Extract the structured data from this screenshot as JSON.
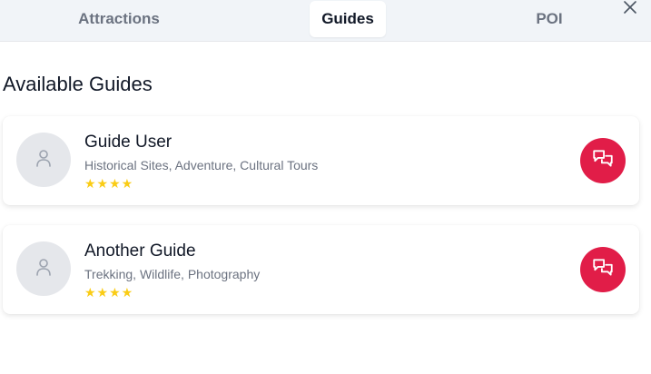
{
  "tabs": [
    {
      "label": "Attractions",
      "active": false
    },
    {
      "label": "Guides",
      "active": true
    },
    {
      "label": "POI",
      "active": false
    }
  ],
  "section_title": "Available Guides",
  "guides": [
    {
      "name": "Guide User",
      "specialties": "Historical Sites, Adventure, Cultural Tours",
      "rating_stars": "★★★★",
      "rating": 4
    },
    {
      "name": "Another Guide",
      "specialties": "Trekking, Wildlife, Photography",
      "rating_stars": "★★★★",
      "rating": 4
    }
  ],
  "icons": {
    "close": "close-icon",
    "avatar": "user-icon",
    "chat": "chat-bubbles-icon"
  },
  "colors": {
    "accent": "#e11d48",
    "star": "#facc15",
    "tabbar_bg": "#f1f4f8"
  }
}
